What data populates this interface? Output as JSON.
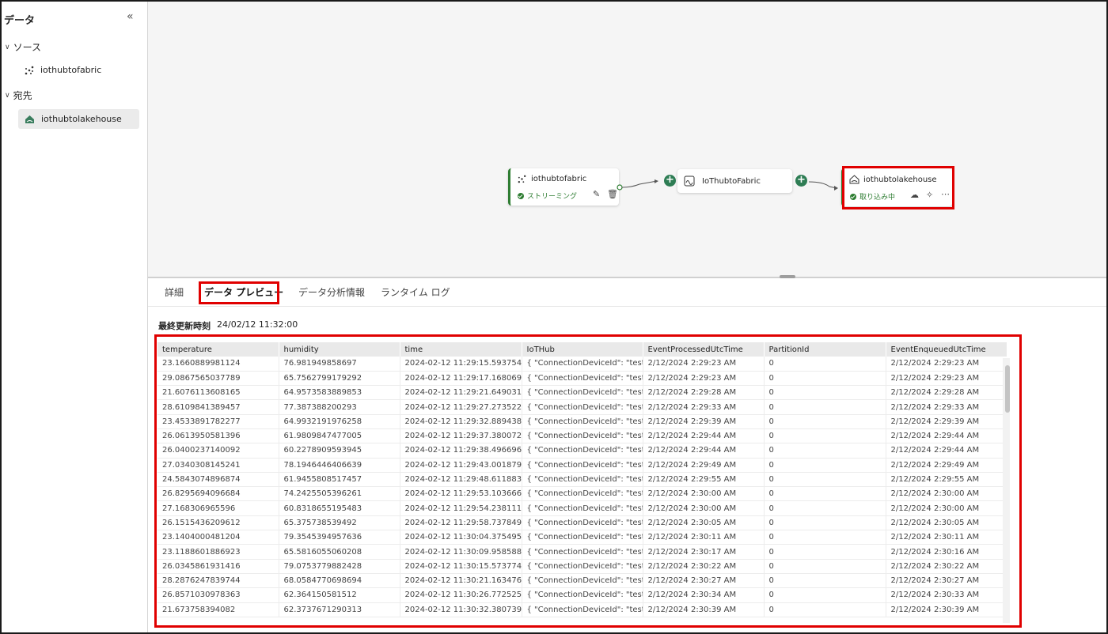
{
  "sidebar": {
    "title": "データ",
    "collapse_icon": "double-chevron-left-icon",
    "sections": [
      {
        "label": "ソース",
        "items": [
          "iothubtofabric"
        ]
      },
      {
        "label": "宛先",
        "items": [
          "iothubtolakehouse"
        ]
      }
    ]
  },
  "canvas": {
    "source_node": {
      "name": "iothubtofabric",
      "status": "ストリーミング"
    },
    "stream_node": {
      "name": "IoThubtoFabric"
    },
    "dest_node": {
      "name": "iothubtolakehouse",
      "status": "取り込み中"
    }
  },
  "tabs": [
    "詳細",
    "データ プレビュー",
    "データ分析情報",
    "ランタイム ログ"
  ],
  "active_tab": "データ プレビュー",
  "last_updated": {
    "label": "最終更新時刻",
    "value": "24/02/12 11:32:00"
  },
  "table": {
    "columns": [
      "temperature",
      "humidity",
      "time",
      "IoTHub",
      "EventProcessedUtcTime",
      "PartitionId",
      "EventEnqueuedUtcTime"
    ],
    "rows": [
      [
        "23.1660889981124",
        "76.981949858697",
        "2024-02-12 11:29:15.593754",
        "{ \"ConnectionDeviceId\": \"test\",",
        "2/12/2024 2:29:23 AM",
        "0",
        "2/12/2024 2:29:23 AM"
      ],
      [
        "29.0867565037789",
        "65.7562799179292",
        "2024-02-12 11:29:17.168069",
        "{ \"ConnectionDeviceId\": \"test\",",
        "2/12/2024 2:29:23 AM",
        "0",
        "2/12/2024 2:29:23 AM"
      ],
      [
        "21.6076113608165",
        "64.9573583889853",
        "2024-02-12 11:29:21.649031",
        "{ \"ConnectionDeviceId\": \"test\",",
        "2/12/2024 2:29:28 AM",
        "0",
        "2/12/2024 2:29:28 AM"
      ],
      [
        "28.6109841389457",
        "77.387388200293",
        "2024-02-12 11:29:27.273522",
        "{ \"ConnectionDeviceId\": \"test\",",
        "2/12/2024 2:29:33 AM",
        "0",
        "2/12/2024 2:29:33 AM"
      ],
      [
        "23.4533891782277",
        "64.9932191976258",
        "2024-02-12 11:29:32.889438",
        "{ \"ConnectionDeviceId\": \"test\",",
        "2/12/2024 2:29:39 AM",
        "0",
        "2/12/2024 2:29:39 AM"
      ],
      [
        "26.0613950581396",
        "61.9809847477005",
        "2024-02-12 11:29:37.380072",
        "{ \"ConnectionDeviceId\": \"test\",",
        "2/12/2024 2:29:44 AM",
        "0",
        "2/12/2024 2:29:44 AM"
      ],
      [
        "26.0400237140092",
        "60.2278909593945",
        "2024-02-12 11:29:38.496696",
        "{ \"ConnectionDeviceId\": \"test\",",
        "2/12/2024 2:29:44 AM",
        "0",
        "2/12/2024 2:29:44 AM"
      ],
      [
        "27.0340308145241",
        "78.1946446406639",
        "2024-02-12 11:29:43.001879",
        "{ \"ConnectionDeviceId\": \"test\",",
        "2/12/2024 2:29:49 AM",
        "0",
        "2/12/2024 2:29:49 AM"
      ],
      [
        "24.5843074896874",
        "61.9455808517457",
        "2024-02-12 11:29:48.611883",
        "{ \"ConnectionDeviceId\": \"test\",",
        "2/12/2024 2:29:55 AM",
        "0",
        "2/12/2024 2:29:55 AM"
      ],
      [
        "26.8295694096684",
        "74.2425505396261",
        "2024-02-12 11:29:53.103666",
        "{ \"ConnectionDeviceId\": \"test\",",
        "2/12/2024 2:30:00 AM",
        "0",
        "2/12/2024 2:30:00 AM"
      ],
      [
        "27.168306965596",
        "60.8318655195483",
        "2024-02-12 11:29:54.238111",
        "{ \"ConnectionDeviceId\": \"test\",",
        "2/12/2024 2:30:00 AM",
        "0",
        "2/12/2024 2:30:00 AM"
      ],
      [
        "26.1515436209612",
        "65.375738539492",
        "2024-02-12 11:29:58.737849",
        "{ \"ConnectionDeviceId\": \"test\",",
        "2/12/2024 2:30:05 AM",
        "0",
        "2/12/2024 2:30:05 AM"
      ],
      [
        "23.1404000481204",
        "79.3545394957636",
        "2024-02-12 11:30:04.375495",
        "{ \"ConnectionDeviceId\": \"test\",",
        "2/12/2024 2:30:11 AM",
        "0",
        "2/12/2024 2:30:11 AM"
      ],
      [
        "23.1188601886923",
        "65.5816055060208",
        "2024-02-12 11:30:09.958588",
        "{ \"ConnectionDeviceId\": \"test\",",
        "2/12/2024 2:30:17 AM",
        "0",
        "2/12/2024 2:30:16 AM"
      ],
      [
        "26.0345861931416",
        "79.0753779882428",
        "2024-02-12 11:30:15.573774",
        "{ \"ConnectionDeviceId\": \"test\",",
        "2/12/2024 2:30:22 AM",
        "0",
        "2/12/2024 2:30:22 AM"
      ],
      [
        "28.2876247839744",
        "68.0584770698694",
        "2024-02-12 11:30:21.163476",
        "{ \"ConnectionDeviceId\": \"test\",",
        "2/12/2024 2:30:27 AM",
        "0",
        "2/12/2024 2:30:27 AM"
      ],
      [
        "26.8571030978363",
        "62.364150581512",
        "2024-02-12 11:30:26.772525",
        "{ \"ConnectionDeviceId\": \"test\",",
        "2/12/2024 2:30:34 AM",
        "0",
        "2/12/2024 2:30:33 AM"
      ],
      [
        "21.673758394082",
        "62.3737671290313",
        "2024-02-12 11:30:32.380739",
        "{ \"ConnectionDeviceId\": \"test\",",
        "2/12/2024 2:30:39 AM",
        "0",
        "2/12/2024 2:30:39 AM"
      ]
    ]
  },
  "colors": {
    "accent_green": "#2e7d32",
    "highlight_red": "#e00000"
  }
}
